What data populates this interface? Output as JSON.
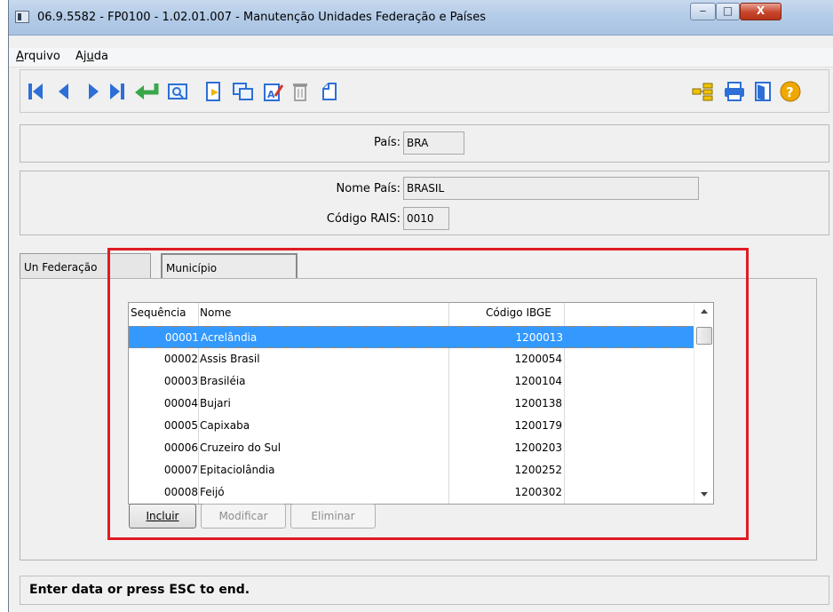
{
  "window": {
    "title": "06.9.5582 - FP0100 - 1.02.01.007 - Manutenção Unidades Federação e Países",
    "minimize": "‒",
    "maximize": "□",
    "close": "X"
  },
  "menu": [
    {
      "label": "Arquivo"
    },
    {
      "label": "Ajuda"
    }
  ],
  "toolbar": {
    "icons": [
      "first-record-icon",
      "previous-record-icon",
      "next-record-icon",
      "last-record-icon",
      "goto-icon",
      "search-icon",
      "new-icon",
      "copy-icon",
      "edit-icon",
      "delete-icon",
      "new-blank-icon",
      "tree-icon",
      "print-icon",
      "exit-icon",
      "help-icon"
    ],
    "help_glyph": "?"
  },
  "form": {
    "pais_label": "País:",
    "pais_value": "BRA",
    "nome_label": "Nome País:",
    "nome_value": "BRASIL",
    "rais_label": "Código RAIS:",
    "rais_value": "0010"
  },
  "tabs": [
    {
      "label": "Un Federação"
    },
    {
      "label": "Município"
    }
  ],
  "grid": {
    "headers": [
      "Sequência",
      "Nome",
      "Código IBGE"
    ],
    "rows": [
      [
        "00001",
        "Acrelândia",
        "1200013"
      ],
      [
        "00002",
        "Assis Brasil",
        "1200054"
      ],
      [
        "00003",
        "Brasiléia",
        "1200104"
      ],
      [
        "00004",
        "Bujari",
        "1200138"
      ],
      [
        "00005",
        "Capixaba",
        "1200179"
      ],
      [
        "00006",
        "Cruzeiro do Sul",
        "1200203"
      ],
      [
        "00007",
        "Epitaciolândia",
        "1200252"
      ],
      [
        "00008",
        "Feijó",
        "1200302"
      ]
    ],
    "selected_row": 0
  },
  "buttons": {
    "incluir": "Incluir",
    "modificar": "Modificar",
    "eliminar": "Eliminar"
  },
  "status": "Enter data or press ESC to end.",
  "colors": {
    "selection": "#3399ff",
    "highlight": "#e01b24"
  }
}
